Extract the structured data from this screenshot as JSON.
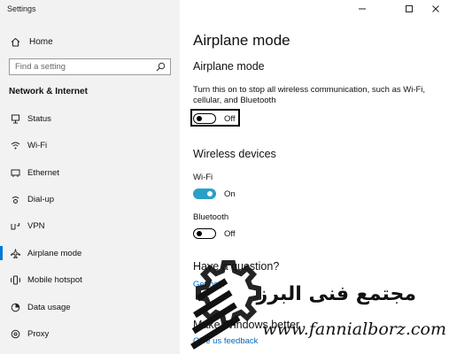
{
  "window": {
    "title": "Settings",
    "controls": {
      "minimize": "minimize-icon",
      "maximize": "maximize-icon",
      "close": "close-icon"
    }
  },
  "sidebar": {
    "home_label": "Home",
    "search": {
      "placeholder": "Find a setting",
      "icon": "search-icon"
    },
    "section_title": "Network & Internet",
    "items": [
      {
        "label": "Status",
        "icon": "status-icon",
        "selected": false
      },
      {
        "label": "Wi-Fi",
        "icon": "wifi-icon",
        "selected": false
      },
      {
        "label": "Ethernet",
        "icon": "ethernet-icon",
        "selected": false
      },
      {
        "label": "Dial-up",
        "icon": "dialup-icon",
        "selected": false
      },
      {
        "label": "VPN",
        "icon": "vpn-icon",
        "selected": false
      },
      {
        "label": "Airplane mode",
        "icon": "airplane-icon",
        "selected": true
      },
      {
        "label": "Mobile hotspot",
        "icon": "hotspot-icon",
        "selected": false
      },
      {
        "label": "Data usage",
        "icon": "data-usage-icon",
        "selected": false
      },
      {
        "label": "Proxy",
        "icon": "proxy-icon",
        "selected": false
      }
    ]
  },
  "main": {
    "page_title": "Airplane mode",
    "airplane": {
      "heading": "Airplane mode",
      "description": "Turn this on to stop all wireless communication, such as Wi-Fi, cellular, and Bluetooth",
      "toggle_state": "Off"
    },
    "wireless": {
      "heading": "Wireless devices",
      "wifi_label": "Wi-Fi",
      "wifi_state": "On",
      "bluetooth_label": "Bluetooth",
      "bluetooth_state": "Off"
    },
    "help": {
      "heading": "Have a question?",
      "link": "Get help"
    },
    "feedback": {
      "heading": "Make Windows better",
      "link": "Give us feedback"
    }
  },
  "watermark": {
    "arabic": "مجتمع فنى البرز",
    "url": "www.fannialborz.com"
  },
  "colors": {
    "accent": "#0078d7",
    "toggle_on": "#2aa0c8",
    "link": "#0067c0",
    "sidebar_bg": "#f2f2f2"
  }
}
